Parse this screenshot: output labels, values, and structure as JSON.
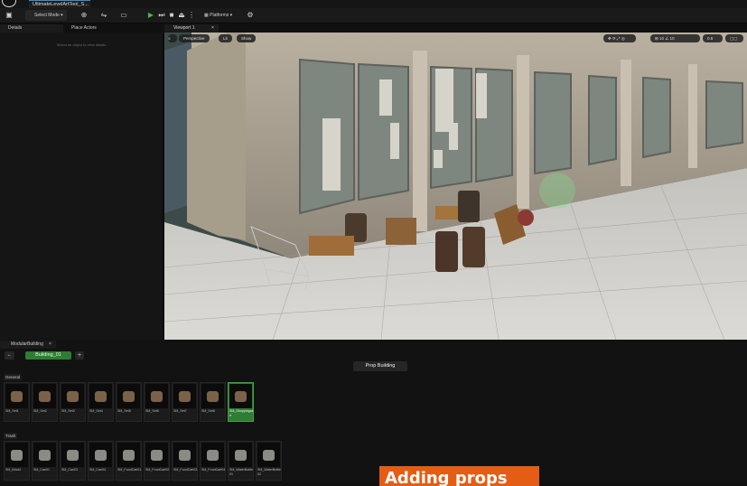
{
  "title_bar": {
    "document_tab": "UltimateLevelArtTool_S...",
    "close_glyph": "×"
  },
  "toolbar": {
    "select_mode": "Select Mode",
    "platforms": "Platforms",
    "play_glyph": "▶"
  },
  "left_panel": {
    "tabs": [
      {
        "label": "Details"
      },
      {
        "label": "Place Actors"
      }
    ],
    "hint": "Select an object to view details."
  },
  "viewport": {
    "tab_label": "Viewport 1",
    "perspective": "Perspective",
    "lit": "Lit",
    "show": "Show",
    "camera_speed": "0.5"
  },
  "bottom_panel": {
    "tab_label": "ModularBuilding",
    "building_button": "Building_01",
    "add_glyph": "+",
    "title": "Prop Building",
    "groups": [
      {
        "label": "General",
        "items": [
          "SM_Set1",
          "SM_Set2",
          "SM_Set3",
          "SM_Set4",
          "SM_Set5",
          "SM_Set6",
          "SM_Set7",
          "SM_Set8",
          "SM_Shoppingcart"
        ]
      },
      {
        "label": "Trash",
        "items": [
          "SM_Brick2",
          "SM_Can01",
          "SM_Can03",
          "SM_Can04",
          "SM_FoodCart01",
          "SM_FoodCart02",
          "SM_FoodCart03",
          "SM_FoodCart04",
          "SM_WaterBottle01",
          "SM_WaterBottle02"
        ]
      }
    ],
    "selected_item": "SM_Shoppingcart"
  },
  "overlay": {
    "banner_text": "Adding props"
  },
  "colors": {
    "accent_green": "#2e7d32",
    "banner_orange": "#e35d14",
    "tab_blue": "#3a8fd6"
  }
}
